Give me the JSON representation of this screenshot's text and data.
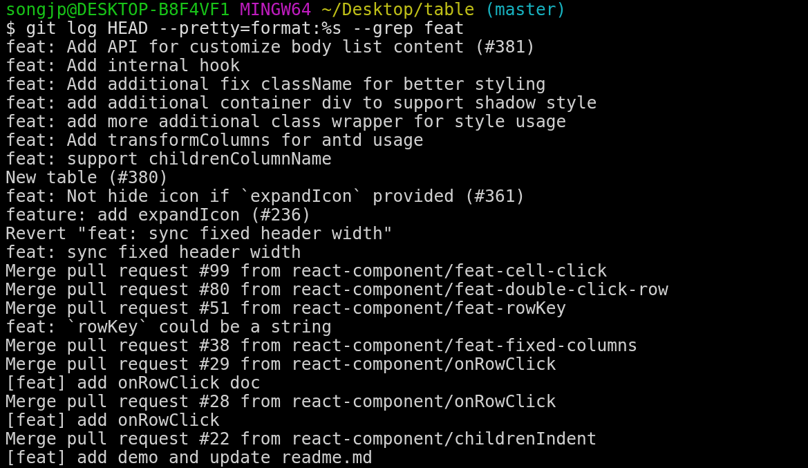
{
  "prompt": {
    "user_host": "songjp@DESKTOP-B8F4VF1",
    "shell": "MINGW64",
    "path": "~/Desktop/table",
    "branch": "(master)"
  },
  "command": "$ git log HEAD --pretty=format:%s --grep feat",
  "output_lines": [
    "feat: Add API for customize body list content (#381)",
    "feat: Add internal hook",
    "feat: Add additional fix className for better styling",
    "feat: add additional container div to support shadow style",
    "feat: add more additional class wrapper for style usage",
    "feat: Add transformColumns for antd usage",
    "feat: support childrenColumnName",
    "New table (#380)",
    "feat: Not hide icon if `expandIcon` provided (#361)",
    "feature: add expandIcon (#236)",
    "Revert \"feat: sync fixed header width\"",
    "feat: sync fixed header width",
    "Merge pull request #99 from react-component/feat-cell-click",
    "Merge pull request #80 from react-component/feat-double-click-row",
    "Merge pull request #51 from react-component/feat-rowKey",
    "feat: `rowKey` could be a string",
    "Merge pull request #38 from react-component/feat-fixed-columns",
    "Merge pull request #29 from react-component/onRowClick",
    "[feat] add onRowClick doc",
    "Merge pull request #28 from react-component/onRowClick",
    "[feat] add onRowClick",
    "Merge pull request #22 from react-component/childrenIndent",
    "[feat] add demo and update readme.md"
  ]
}
